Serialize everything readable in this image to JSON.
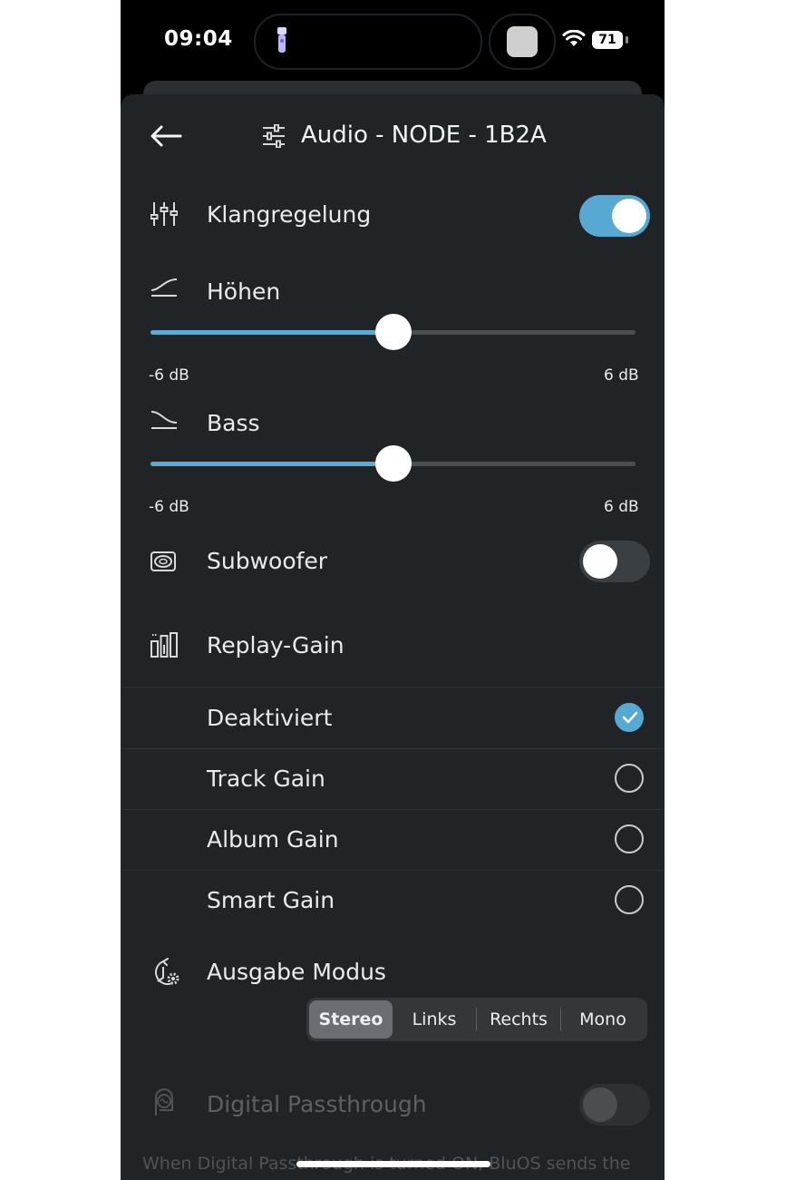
{
  "status_bar": {
    "time": "09:04",
    "battery": "71"
  },
  "header": {
    "title": "Audio - NODE - 1B2A"
  },
  "tone_control": {
    "label": "Klangregelung",
    "enabled": true
  },
  "treble": {
    "label": "Höhen",
    "min_label": "-6 dB",
    "max_label": "6 dB",
    "value_fraction": 0.5
  },
  "bass": {
    "label": "Bass",
    "min_label": "-6 dB",
    "max_label": "6 dB",
    "value_fraction": 0.5
  },
  "subwoofer": {
    "label": "Subwoofer",
    "enabled": false
  },
  "replay_gain": {
    "label": "Replay-Gain",
    "options": [
      {
        "label": "Deaktiviert",
        "selected": true
      },
      {
        "label": "Track Gain",
        "selected": false
      },
      {
        "label": "Album Gain",
        "selected": false
      },
      {
        "label": "Smart Gain",
        "selected": false
      }
    ]
  },
  "output_mode": {
    "label": "Ausgabe Modus",
    "options": [
      "Stereo",
      "Links",
      "Rechts",
      "Mono"
    ],
    "selected": "Stereo"
  },
  "digital_passthrough": {
    "label": "Digital Passthrough",
    "enabled": false,
    "description": "When Digital Passthrough is turned ON, BluOS sends the"
  },
  "colors": {
    "accent": "#57a9d3",
    "sheet": "#202427",
    "text": "#e9ecee"
  }
}
